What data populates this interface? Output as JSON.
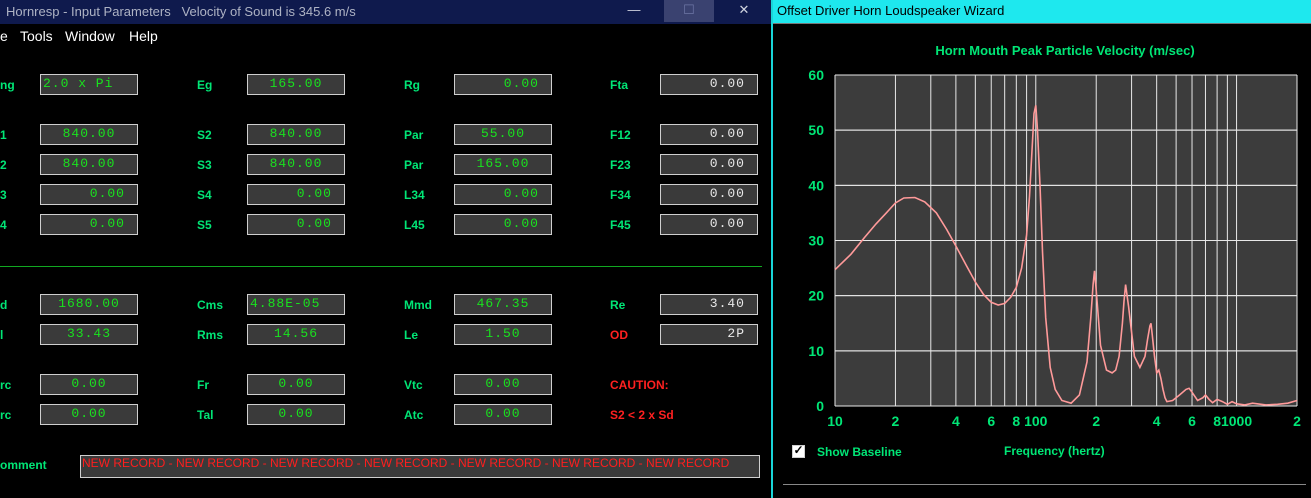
{
  "left_window": {
    "title": "Hornresp - Input Parameters   Velocity of Sound is 345.6 m/s",
    "controls": {
      "minimize": "—",
      "maximize": "☐",
      "close": "✕"
    },
    "menu": [
      "e",
      "Tools",
      "Window",
      "Help"
    ],
    "rows": [
      [
        {
          "label": "ng",
          "value": "2.0 x Pi",
          "align": "left"
        },
        {
          "label": "Eg",
          "value": "165.00"
        },
        {
          "label": "Rg",
          "value": "0.00",
          "align": "right"
        },
        {
          "label": "Fta",
          "value": "0.00",
          "align": "right",
          "white": true
        }
      ],
      [
        {
          "label": "1",
          "value": "840.00"
        },
        {
          "label": "S2",
          "value": "840.00"
        },
        {
          "label": "Par",
          "value": "55.00"
        },
        {
          "label": "F12",
          "value": "0.00",
          "align": "right",
          "white": true
        }
      ],
      [
        {
          "label": "2",
          "value": "840.00"
        },
        {
          "label": "S3",
          "value": "840.00"
        },
        {
          "label": "Par",
          "value": "165.00"
        },
        {
          "label": "F23",
          "value": "0.00",
          "align": "right",
          "white": true
        }
      ],
      [
        {
          "label": "3",
          "value": "0.00",
          "align": "right"
        },
        {
          "label": "S4",
          "value": "0.00",
          "align": "right"
        },
        {
          "label": "L34",
          "value": "0.00",
          "align": "right"
        },
        {
          "label": "F34",
          "value": "0.00",
          "align": "right",
          "white": true
        }
      ],
      [
        {
          "label": "4",
          "value": "0.00",
          "align": "right"
        },
        {
          "label": "S5",
          "value": "0.00",
          "align": "right"
        },
        {
          "label": "L45",
          "value": "0.00",
          "align": "right"
        },
        {
          "label": "F45",
          "value": "0.00",
          "align": "right",
          "white": true
        }
      ],
      [
        {
          "label": "d",
          "value": "1680.00"
        },
        {
          "label": "Cms",
          "value": "4.88E-05",
          "align": "left"
        },
        {
          "label": "Mmd",
          "value": "467.35"
        },
        {
          "label": "Re",
          "value": "3.40",
          "align": "right",
          "white": true
        }
      ],
      [
        {
          "label": "l",
          "value": "33.43"
        },
        {
          "label": "Rms",
          "value": "14.56"
        },
        {
          "label": "Le",
          "value": "1.50"
        },
        {
          "label": "OD",
          "value": "2P",
          "align": "right",
          "white": true,
          "red_label": true
        }
      ],
      [
        {
          "label": "rc",
          "value": "0.00"
        },
        {
          "label": "Fr",
          "value": "0.00"
        },
        {
          "label": "Vtc",
          "value": "0.00"
        },
        {
          "label": "CAUTION:",
          "red_label": true,
          "no_field": true
        }
      ],
      [
        {
          "label": "rc",
          "value": "0.00"
        },
        {
          "label": "Tal",
          "value": "0.00"
        },
        {
          "label": "Atc",
          "value": "0.00"
        },
        {
          "label": "S2 < 2 x Sd",
          "red_label": true,
          "no_field": true
        }
      ]
    ],
    "comment_label": "omment",
    "comment_value": "NEW RECORD - NEW RECORD - NEW RECORD - NEW RECORD - NEW RECORD - NEW RECORD - NEW RECORD"
  },
  "right_window": {
    "title": "Offset Driver Horn Loudspeaker Wizard",
    "show_baseline_label": "Show Baseline",
    "show_baseline_checked": true
  },
  "chart_data": {
    "type": "line",
    "title": "Horn Mouth Peak Particle Velocity (m/sec)",
    "xlabel": "Frequency (hertz)",
    "ylabel": "",
    "x_scale": "log",
    "xlim": [
      10,
      2000
    ],
    "ylim": [
      0,
      60
    ],
    "grid": true,
    "line_color": "#ff9a9a",
    "plot_bg": "#3c3c3c",
    "grid_color": "#e8e8e8",
    "x_tick_labels": [
      "10",
      "2",
      "4",
      "6",
      "8",
      "100",
      "2",
      "4",
      "6",
      "8",
      "1000",
      "2"
    ],
    "x_tick_values": [
      10,
      20,
      40,
      60,
      80,
      100,
      200,
      400,
      600,
      800,
      1000,
      2000
    ],
    "y_tick_labels": [
      "0",
      "10",
      "20",
      "30",
      "40",
      "50",
      "60"
    ],
    "series": [
      {
        "x": [
          10,
          12,
          14,
          16,
          18,
          20,
          22,
          25,
          28,
          32,
          36,
          40,
          45,
          50,
          55,
          60,
          65,
          70,
          75,
          80,
          85,
          90,
          93,
          96,
          98,
          100,
          102,
          105,
          108,
          112,
          118,
          125,
          135,
          150,
          165,
          180,
          188,
          193,
          196,
          200,
          210,
          225,
          240,
          250,
          260,
          270,
          275,
          280,
          290,
          310,
          330,
          350,
          360,
          370,
          375,
          380,
          390,
          400,
          410,
          420,
          430,
          440,
          450,
          480,
          520,
          560,
          580,
          600,
          640,
          680,
          700,
          730,
          760,
          800,
          850,
          900,
          950,
          1000,
          1100,
          1200,
          1400,
          1600,
          1800,
          2000
        ],
        "y": [
          24.7,
          27.5,
          30.5,
          33,
          35,
          36.8,
          37.7,
          37.8,
          37,
          35,
          32,
          29,
          25.5,
          22.5,
          20.2,
          18.8,
          18.3,
          18.6,
          19.7,
          21.5,
          25,
          31,
          38,
          47,
          53,
          54.5,
          50,
          40,
          28,
          16,
          7,
          3,
          1,
          0.5,
          2,
          8,
          16,
          22,
          24.5,
          21,
          11,
          6.5,
          6,
          6.5,
          9,
          15,
          19,
          22,
          18,
          9,
          7,
          9,
          12,
          14.5,
          15,
          13,
          9,
          6,
          6.5,
          5,
          3,
          1.5,
          0.8,
          1,
          2,
          3,
          3.2,
          2.5,
          1,
          1.5,
          2,
          1.2,
          0.6,
          1.2,
          0.8,
          0.3,
          0.8,
          0.4,
          0.2,
          0.5,
          0.2,
          0.3,
          0.5,
          1
        ]
      }
    ]
  }
}
